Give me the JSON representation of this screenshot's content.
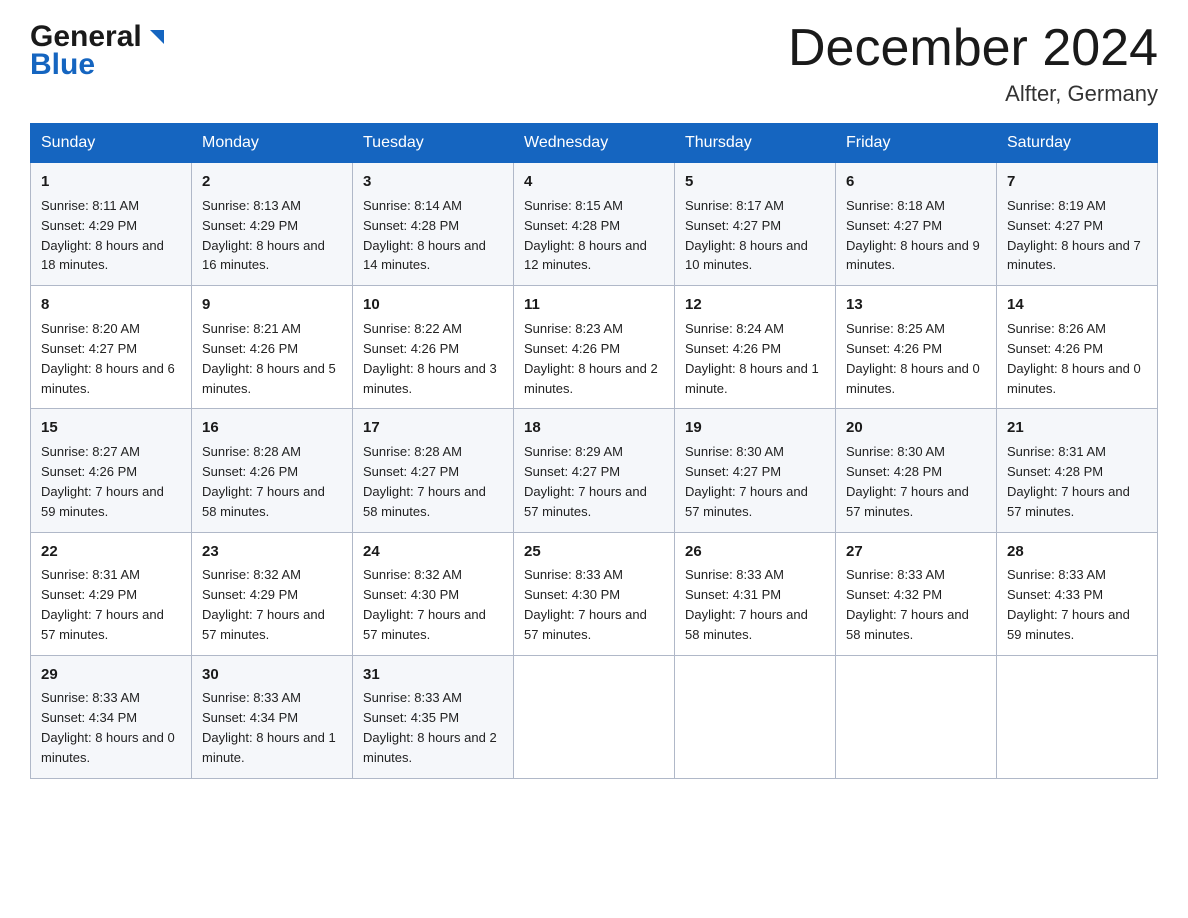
{
  "header": {
    "logo_general": "General",
    "logo_blue": "Blue",
    "month_title": "December 2024",
    "location": "Alfter, Germany"
  },
  "weekdays": [
    "Sunday",
    "Monday",
    "Tuesday",
    "Wednesday",
    "Thursday",
    "Friday",
    "Saturday"
  ],
  "weeks": [
    [
      {
        "day": "1",
        "sunrise": "8:11 AM",
        "sunset": "4:29 PM",
        "daylight": "8 hours and 18 minutes."
      },
      {
        "day": "2",
        "sunrise": "8:13 AM",
        "sunset": "4:29 PM",
        "daylight": "8 hours and 16 minutes."
      },
      {
        "day": "3",
        "sunrise": "8:14 AM",
        "sunset": "4:28 PM",
        "daylight": "8 hours and 14 minutes."
      },
      {
        "day": "4",
        "sunrise": "8:15 AM",
        "sunset": "4:28 PM",
        "daylight": "8 hours and 12 minutes."
      },
      {
        "day": "5",
        "sunrise": "8:17 AM",
        "sunset": "4:27 PM",
        "daylight": "8 hours and 10 minutes."
      },
      {
        "day": "6",
        "sunrise": "8:18 AM",
        "sunset": "4:27 PM",
        "daylight": "8 hours and 9 minutes."
      },
      {
        "day": "7",
        "sunrise": "8:19 AM",
        "sunset": "4:27 PM",
        "daylight": "8 hours and 7 minutes."
      }
    ],
    [
      {
        "day": "8",
        "sunrise": "8:20 AM",
        "sunset": "4:27 PM",
        "daylight": "8 hours and 6 minutes."
      },
      {
        "day": "9",
        "sunrise": "8:21 AM",
        "sunset": "4:26 PM",
        "daylight": "8 hours and 5 minutes."
      },
      {
        "day": "10",
        "sunrise": "8:22 AM",
        "sunset": "4:26 PM",
        "daylight": "8 hours and 3 minutes."
      },
      {
        "day": "11",
        "sunrise": "8:23 AM",
        "sunset": "4:26 PM",
        "daylight": "8 hours and 2 minutes."
      },
      {
        "day": "12",
        "sunrise": "8:24 AM",
        "sunset": "4:26 PM",
        "daylight": "8 hours and 1 minute."
      },
      {
        "day": "13",
        "sunrise": "8:25 AM",
        "sunset": "4:26 PM",
        "daylight": "8 hours and 0 minutes."
      },
      {
        "day": "14",
        "sunrise": "8:26 AM",
        "sunset": "4:26 PM",
        "daylight": "8 hours and 0 minutes."
      }
    ],
    [
      {
        "day": "15",
        "sunrise": "8:27 AM",
        "sunset": "4:26 PM",
        "daylight": "7 hours and 59 minutes."
      },
      {
        "day": "16",
        "sunrise": "8:28 AM",
        "sunset": "4:26 PM",
        "daylight": "7 hours and 58 minutes."
      },
      {
        "day": "17",
        "sunrise": "8:28 AM",
        "sunset": "4:27 PM",
        "daylight": "7 hours and 58 minutes."
      },
      {
        "day": "18",
        "sunrise": "8:29 AM",
        "sunset": "4:27 PM",
        "daylight": "7 hours and 57 minutes."
      },
      {
        "day": "19",
        "sunrise": "8:30 AM",
        "sunset": "4:27 PM",
        "daylight": "7 hours and 57 minutes."
      },
      {
        "day": "20",
        "sunrise": "8:30 AM",
        "sunset": "4:28 PM",
        "daylight": "7 hours and 57 minutes."
      },
      {
        "day": "21",
        "sunrise": "8:31 AM",
        "sunset": "4:28 PM",
        "daylight": "7 hours and 57 minutes."
      }
    ],
    [
      {
        "day": "22",
        "sunrise": "8:31 AM",
        "sunset": "4:29 PM",
        "daylight": "7 hours and 57 minutes."
      },
      {
        "day": "23",
        "sunrise": "8:32 AM",
        "sunset": "4:29 PM",
        "daylight": "7 hours and 57 minutes."
      },
      {
        "day": "24",
        "sunrise": "8:32 AM",
        "sunset": "4:30 PM",
        "daylight": "7 hours and 57 minutes."
      },
      {
        "day": "25",
        "sunrise": "8:33 AM",
        "sunset": "4:30 PM",
        "daylight": "7 hours and 57 minutes."
      },
      {
        "day": "26",
        "sunrise": "8:33 AM",
        "sunset": "4:31 PM",
        "daylight": "7 hours and 58 minutes."
      },
      {
        "day": "27",
        "sunrise": "8:33 AM",
        "sunset": "4:32 PM",
        "daylight": "7 hours and 58 minutes."
      },
      {
        "day": "28",
        "sunrise": "8:33 AM",
        "sunset": "4:33 PM",
        "daylight": "7 hours and 59 minutes."
      }
    ],
    [
      {
        "day": "29",
        "sunrise": "8:33 AM",
        "sunset": "4:34 PM",
        "daylight": "8 hours and 0 minutes."
      },
      {
        "day": "30",
        "sunrise": "8:33 AM",
        "sunset": "4:34 PM",
        "daylight": "8 hours and 1 minute."
      },
      {
        "day": "31",
        "sunrise": "8:33 AM",
        "sunset": "4:35 PM",
        "daylight": "8 hours and 2 minutes."
      },
      null,
      null,
      null,
      null
    ]
  ],
  "labels": {
    "sunrise": "Sunrise:",
    "sunset": "Sunset:",
    "daylight": "Daylight:"
  }
}
